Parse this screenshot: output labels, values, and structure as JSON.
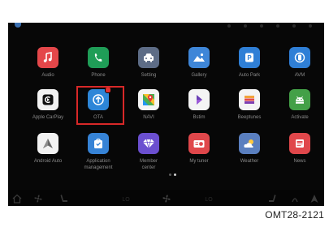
{
  "apps": [
    {
      "label": "Audio",
      "icon": "music-note-icon",
      "color": "#e4474a"
    },
    {
      "label": "Phone",
      "icon": "phone-icon",
      "color": "#1f9d57"
    },
    {
      "label": "Setting",
      "icon": "car-settings-icon",
      "color": "#5d6c86"
    },
    {
      "label": "Gallery",
      "icon": "gallery-icon",
      "color": "#3e86d8"
    },
    {
      "label": "Auto Park",
      "icon": "auto-park-icon",
      "color": "#2f7fd6"
    },
    {
      "label": "AVM",
      "icon": "avm-icon",
      "color": "#2f7fd6"
    },
    {
      "label": "Apple CarPlay",
      "icon": "carplay-icon",
      "color": "#f2f2f2"
    },
    {
      "label": "OTA",
      "icon": "ota-update-icon",
      "color": "#2d86d8",
      "badge": true
    },
    {
      "label": "NAVI",
      "icon": "map-pin-icon",
      "color": "#f4f4f4"
    },
    {
      "label": "Bstim",
      "icon": "bstim-icon",
      "color": "#f4f4f4"
    },
    {
      "label": "Beeptunes",
      "icon": "beeptunes-icon",
      "color": "#f4f4f4"
    },
    {
      "label": "Activate",
      "icon": "android-activate-icon",
      "color": "#43a047"
    },
    {
      "label": "Android Auto",
      "icon": "android-auto-icon",
      "color": "#f2f2f2"
    },
    {
      "label": "Application\nmanagement",
      "icon": "app-store-icon",
      "color": "#3683d6"
    },
    {
      "label": "Member\ncenter",
      "icon": "diamond-icon",
      "color": "#6b4fd0"
    },
    {
      "label": "My tuner",
      "icon": "radio-icon",
      "color": "#e0474b"
    },
    {
      "label": "Weather",
      "icon": "weather-icon",
      "color": "#5a7fbf"
    },
    {
      "label": "News",
      "icon": "news-icon",
      "color": "#e0474b"
    }
  ],
  "dock": [
    {
      "icon": "home-icon"
    },
    {
      "icon": "fan-icon"
    },
    {
      "icon": "seat-icon"
    },
    {
      "icon": "temp-left-icon"
    },
    {
      "icon": "ac-fan-icon"
    },
    {
      "icon": "temp-right-icon"
    },
    {
      "icon": "seat-right-icon"
    },
    {
      "icon": "defrost-icon"
    },
    {
      "icon": "navigation-arrow-icon"
    }
  ],
  "pagination": {
    "pages": 2,
    "active": 1
  },
  "caption": "OMT28-2121"
}
